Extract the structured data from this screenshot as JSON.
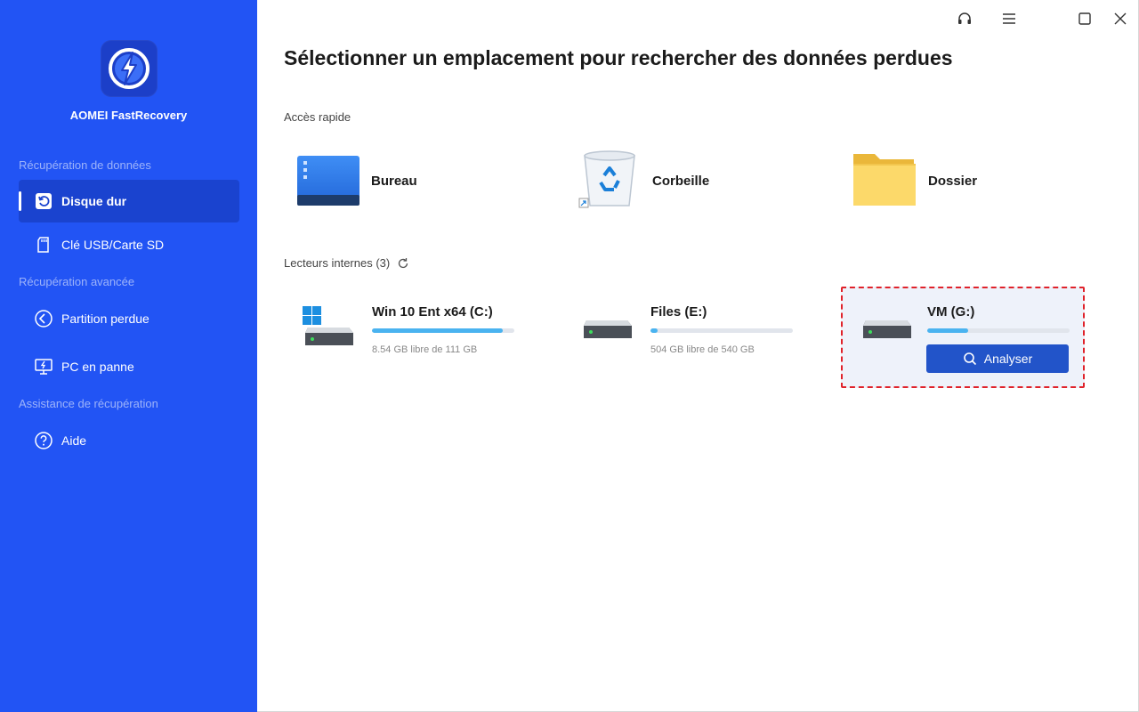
{
  "app": {
    "name": "AOMEI FastRecovery"
  },
  "sidebar": {
    "sections": [
      {
        "title": "Récupération de données"
      },
      {
        "title": "Récupération avancée"
      },
      {
        "title": "Assistance de récupération"
      }
    ],
    "items": [
      {
        "label": "Disque dur",
        "icon": "hard-disk-icon",
        "active": true
      },
      {
        "label": "Clé USB/Carte SD",
        "icon": "sd-card-icon"
      },
      {
        "label": "Partition perdue",
        "icon": "partition-icon"
      },
      {
        "label": "PC en panne",
        "icon": "crashed-pc-icon"
      },
      {
        "label": "Aide",
        "icon": "help-icon"
      }
    ]
  },
  "window_controls": [
    "headset-icon",
    "menu-icon",
    "maximize-icon",
    "close-icon"
  ],
  "main": {
    "title": "Sélectionner un emplacement pour rechercher des données perdues",
    "quick_access": {
      "title": "Accès rapide",
      "items": [
        {
          "label": "Bureau",
          "icon": "desktop-icon"
        },
        {
          "label": "Corbeille",
          "icon": "recycle-bin-icon"
        },
        {
          "label": "Dossier",
          "icon": "folder-icon"
        }
      ]
    },
    "drives_section": {
      "title": "Lecteurs internes (3)",
      "drives": [
        {
          "name": "Win 10 Ent x64 (C:)",
          "free": "8.54 GB libre de 111 GB",
          "used_fraction": 0.92
        },
        {
          "name": "Files (E:)",
          "free": "504 GB libre de 540 GB",
          "used_fraction": 0.05
        },
        {
          "name": "VM (G:)",
          "free": "",
          "used_fraction": 0.29,
          "selected": true,
          "button": "Analyser"
        }
      ]
    }
  },
  "colors": {
    "sidebar": "#2254f4",
    "accent": "#2254c9",
    "progress": "#4ab3f0",
    "selection_border": "#e0222a"
  }
}
